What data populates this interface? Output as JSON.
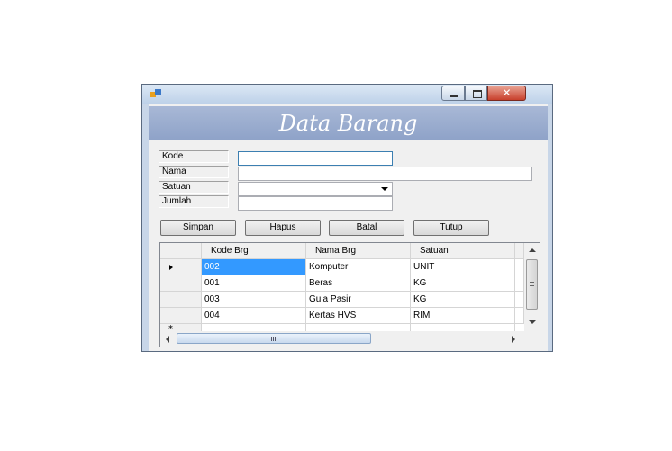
{
  "window": {
    "title": ""
  },
  "header": {
    "title": "Data Barang"
  },
  "form": {
    "kode_label": "Kode",
    "nama_label": "Nama",
    "satuan_label": "Satuan",
    "jumlah_label": "Jumlah",
    "kode_value": "",
    "nama_value": "",
    "satuan_value": "",
    "jumlah_value": ""
  },
  "buttons": {
    "simpan": "Simpan",
    "hapus": "Hapus",
    "batal": "Batal",
    "tutup": "Tutup"
  },
  "grid": {
    "columns": [
      "Kode Brg",
      "Nama Brg",
      "Satuan"
    ],
    "rows": [
      [
        "002",
        "Komputer",
        "UNIT"
      ],
      [
        "001",
        "Beras",
        "KG"
      ],
      [
        "003",
        "Gula Pasir",
        "KG"
      ],
      [
        "004",
        "Kertas HVS",
        "RIM"
      ]
    ],
    "selected_row": 0,
    "new_row_marker": "*"
  },
  "colors": {
    "banner": "#8ea2c8",
    "selection": "#3399ff",
    "close_button": "#c8402c"
  }
}
